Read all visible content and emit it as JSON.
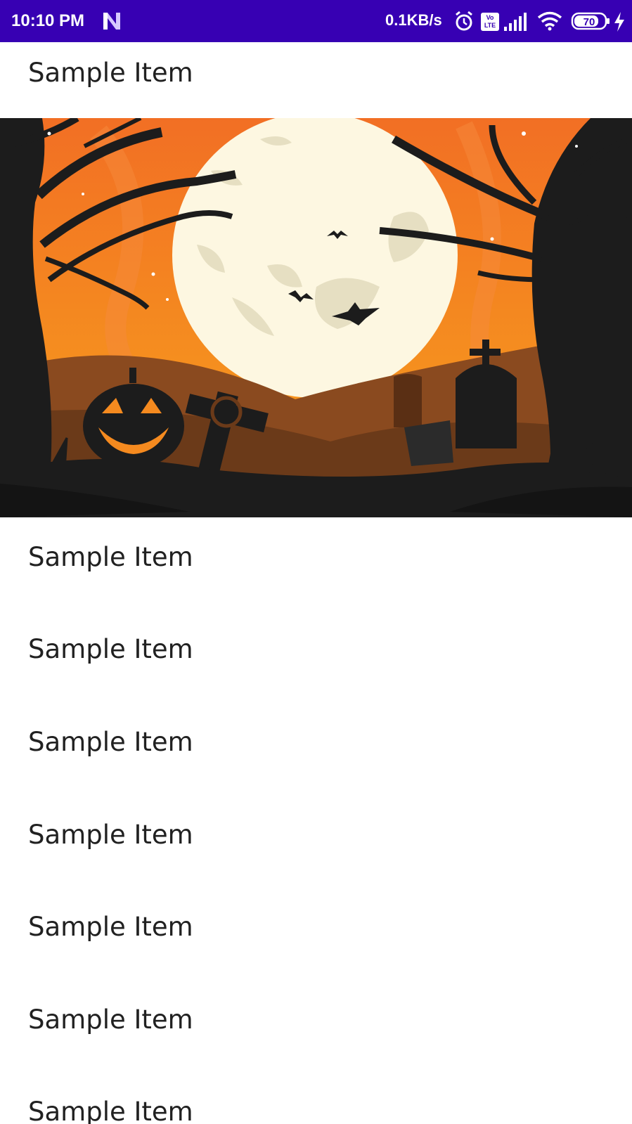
{
  "status_bar": {
    "time": "10:10 PM",
    "network_speed": "0.1KB/s",
    "volte_label": "Vo LTE",
    "battery_level": "70",
    "background_color": "#3700b3",
    "icons": [
      "n-app-icon",
      "alarm-icon",
      "volte-icon",
      "signal-icon",
      "wifi-icon",
      "battery-icon",
      "charging-icon"
    ]
  },
  "list": {
    "items": [
      {
        "label": "Sample Item"
      },
      {
        "label": "Sample Item"
      },
      {
        "label": "Sample Item"
      },
      {
        "label": "Sample Item"
      },
      {
        "label": "Sample Item"
      },
      {
        "label": "Sample Item"
      },
      {
        "label": "Sample Item"
      },
      {
        "label": "Sample Item"
      }
    ]
  },
  "banner": {
    "image": "halloween-graveyard-illustration"
  }
}
